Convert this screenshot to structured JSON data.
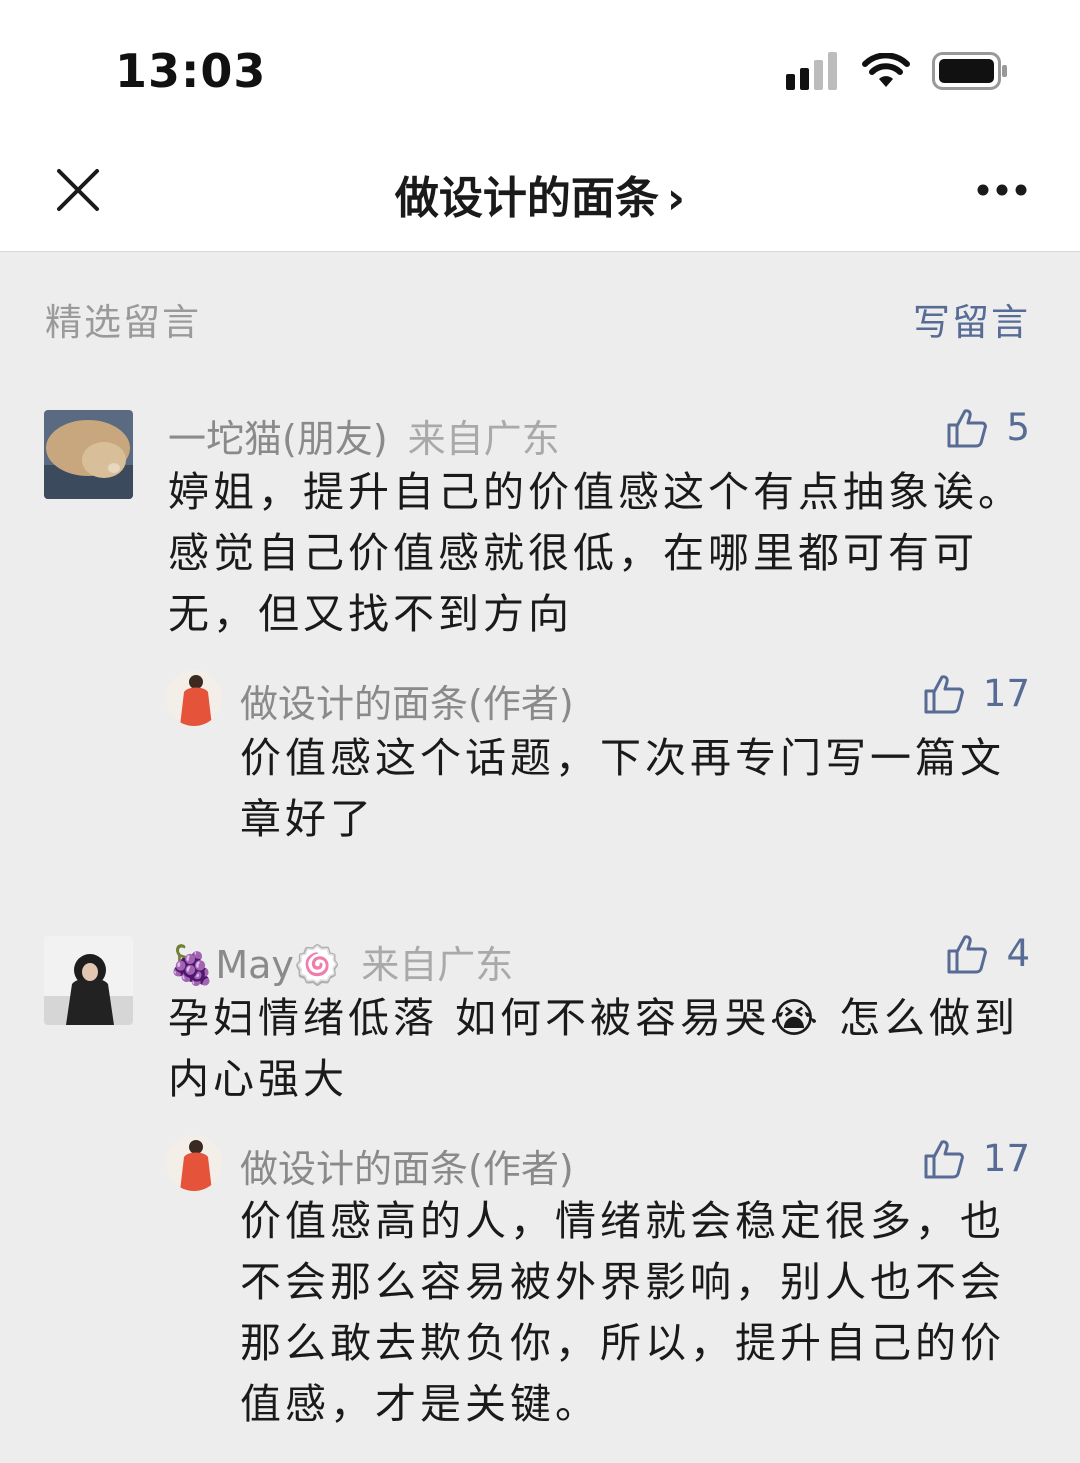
{
  "status_bar": {
    "time": "13:03",
    "signal_icon": "cellular-signal-icon",
    "wifi_icon": "wifi-icon",
    "battery_icon": "battery-icon"
  },
  "nav": {
    "title": "做设计的面条",
    "chevron": "›",
    "close_icon": "close-icon",
    "more_icon": "more-icon"
  },
  "section": {
    "label": "精选留言",
    "write_label": "写留言"
  },
  "comments": [
    {
      "name": "一坨猫(朋友)",
      "location": "来自广东",
      "likes": "5",
      "text": "婷姐，提升自己的价值感这个有点抽象诶。感觉自己价值感就很低，在哪里都可有可无，但又找不到方向",
      "reply": {
        "name": "做设计的面条(作者)",
        "likes": "17",
        "text": "价值感这个话题，下次再专门写一篇文章好了"
      }
    },
    {
      "name_prefix": "🍇",
      "name": "May",
      "name_suffix": "🍥",
      "location": "来自广东",
      "likes": "4",
      "text": "孕妇情绪低落 如何不被容易哭😭 怎么做到内心强大",
      "reply": {
        "name": "做设计的面条(作者)",
        "likes": "17",
        "text": "价值感高的人，情绪就会稳定很多，也不会那么容易被外界影响，别人也不会那么敢去欺负你，所以，提升自己的价值感，才是关键。"
      }
    }
  ],
  "colors": {
    "link": "#576b95",
    "background": "#ededed",
    "meta": "#8a8a8a"
  }
}
